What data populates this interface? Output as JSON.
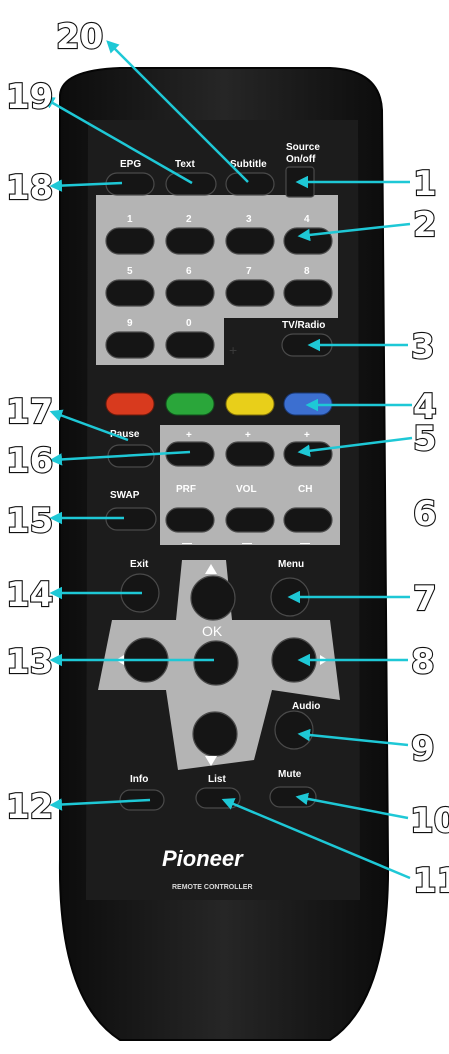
{
  "brand": {
    "name": "Pioneer",
    "subtitle": "REMOTE CONTROLLER"
  },
  "labels": {
    "epg": "EPG",
    "text": "Text",
    "subtitle": "Subtitle",
    "source_line1": "Source",
    "source_line2": "On/off",
    "digits": [
      "1",
      "2",
      "3",
      "4",
      "5",
      "6",
      "7",
      "8",
      "9",
      "0"
    ],
    "tv_radio": "TV/Radio",
    "pause": "Pause",
    "swap": "SWAP",
    "plus": "+",
    "minus": "—",
    "prf": "PRF",
    "vol": "VOL",
    "ch": "CH",
    "exit": "Exit",
    "menu": "Menu",
    "ok": "OK",
    "audio": "Audio",
    "info": "Info",
    "list": "List",
    "mute": "Mute"
  },
  "callouts": [
    "1",
    "2",
    "3",
    "4",
    "5",
    "6",
    "7",
    "8",
    "9",
    "10",
    "11",
    "12",
    "13",
    "14",
    "15",
    "16",
    "17",
    "18",
    "19",
    "20"
  ],
  "colors": {
    "callout_line": "#1ec8d6",
    "red_key": "#d83a1e",
    "green_key": "#2aa63a",
    "yellow_key": "#e8cf1a",
    "blue_key": "#3c6fd0"
  }
}
